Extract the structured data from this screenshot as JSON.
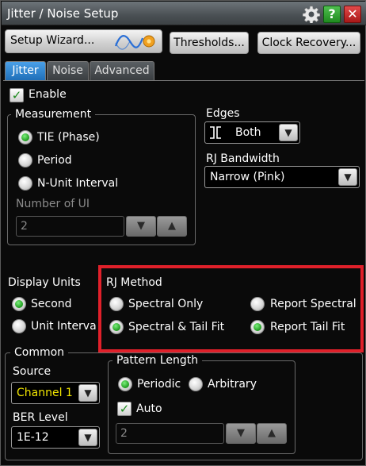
{
  "window": {
    "title": "Jitter / Noise Setup",
    "help_glyph": "?",
    "close_glyph": "✕"
  },
  "toolbar": {
    "setup_wizard": "Setup Wizard...",
    "thresholds": "Thresholds...",
    "clock_recovery": "Clock Recovery..."
  },
  "tabs": [
    "Jitter",
    "Noise",
    "Advanced"
  ],
  "jitter": {
    "enable_label": "Enable",
    "enable_checked": true,
    "measurement": {
      "title": "Measurement",
      "options": [
        "TIE (Phase)",
        "Period",
        "N-Unit Interval"
      ],
      "selected": "TIE (Phase)",
      "number_of_ui_label": "Number of UI",
      "number_of_ui_value": "2"
    },
    "edges": {
      "label": "Edges",
      "value": "Both"
    },
    "rj_bandwidth": {
      "label": "RJ Bandwidth",
      "value": "Narrow (Pink)"
    },
    "display_units": {
      "label": "Display Units",
      "options": [
        "Second",
        "Unit Interva"
      ],
      "selected": "Second"
    },
    "rj_method": {
      "label": "RJ Method",
      "options": [
        "Spectral Only",
        "Report Spectral",
        "Spectral & Tail Fit",
        "Report Tail Fit"
      ],
      "selected": [
        "Spectral & Tail Fit",
        "Report Tail Fit"
      ]
    }
  },
  "common": {
    "title": "Common",
    "source_label": "Source",
    "source_value": "Channel 1",
    "ber_label": "BER Level",
    "ber_value": "1E-12",
    "pattern_length": {
      "title": "Pattern Length",
      "options": [
        "Periodic",
        "Arbitrary"
      ],
      "selected": "Periodic",
      "auto_label": "Auto",
      "auto_checked": true,
      "value": "2"
    }
  },
  "colors": {
    "source_text": "#f2e600",
    "highlight": "#e0202a",
    "tab_active": "#2a85d6"
  }
}
